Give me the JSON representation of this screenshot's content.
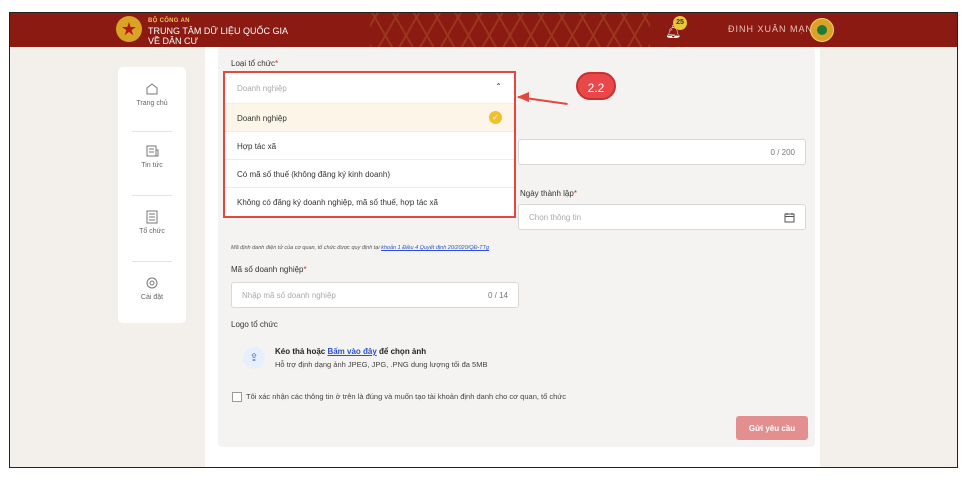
{
  "header": {
    "brand_top": "BỘ CÔNG AN",
    "brand_line1": "TRUNG TÂM DỮ LIỆU QUỐC GIA",
    "brand_line2": "VỀ DÂN CƯ",
    "notification_count": "25",
    "username": "ĐINH XUÂN MẠNH"
  },
  "sidebar": {
    "items": [
      {
        "label": "Trang chủ",
        "icon": "home-icon"
      },
      {
        "label": "Tin tức",
        "icon": "news-icon"
      },
      {
        "label": "Tổ chức",
        "icon": "building-icon"
      },
      {
        "label": "Cài đặt",
        "icon": "gear-icon"
      }
    ]
  },
  "form": {
    "org_type_label": "Loại tổ chức",
    "org_type_placeholder": "Doanh nghiệp",
    "org_type_options": [
      "Doanh nghiệp",
      "Hợp tác xã",
      "Có mã số thuế (không đăng ký kinh doanh)",
      "Không có đăng ký doanh nghiệp, mã số thuế, hợp tác xã"
    ],
    "selected_index": 0,
    "name_counter": "0 / 200",
    "founding_date_label": "Ngày thành lập",
    "founding_date_placeholder": "Chọn thông tin",
    "hint_text": "Mã định danh điện tử của cơ quan, tổ chức được quy định tại ",
    "hint_link": "khoản 1 Điều 4 Quyết định 20/2020/QĐ-TTg",
    "biz_code_label": "Mã số doanh nghiệp",
    "biz_code_placeholder": "Nhập mã số doanh nghiệp",
    "biz_code_counter": "0 / 14",
    "logo_label": "Logo tổ chức",
    "upload_prefix": "Kéo thả hoặc ",
    "upload_link": "Bấm vào đây",
    "upload_suffix": " để chọn ảnh",
    "upload_hint": "Hỗ trợ định dạng ảnh JPEG, JPG, .PNG dung lượng tối đa 5MB",
    "confirm_text": "Tôi xác nhận các thông tin ở trên là đúng và muốn tạo tài khoản định danh cho cơ quan, tổ chức",
    "submit_label": "Gửi yêu cầu"
  },
  "annotation": {
    "callout_label": "2.2"
  }
}
